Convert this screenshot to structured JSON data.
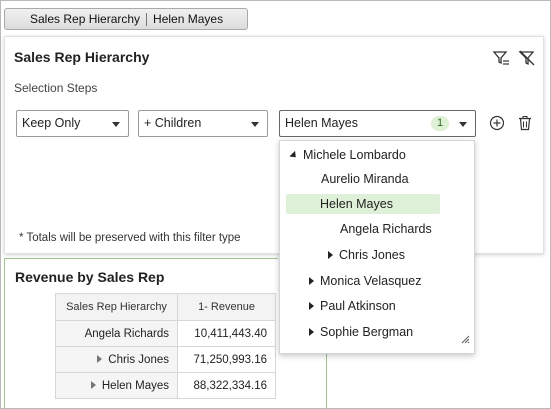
{
  "breadcrumb": {
    "part1": "Sales Rep Hierarchy",
    "part2": "Helen Mayes"
  },
  "filter_panel": {
    "title": "Sales Rep Hierarchy",
    "subtitle": "Selection Steps",
    "action_select": "Keep Only",
    "relation_select": "+ Children",
    "member_select": "Helen Mayes",
    "member_count": "1",
    "note": "* Totals will be preserved with this filter type"
  },
  "dropdown": {
    "items": [
      {
        "label": "Michele Lombardo",
        "state": "expanded"
      },
      {
        "label": "Aurelio Miranda",
        "state": "leaf"
      },
      {
        "label": "Helen Mayes",
        "state": "selected"
      },
      {
        "label": "Angela Richards",
        "state": "leaf"
      },
      {
        "label": "Chris Jones",
        "state": "collapsed"
      },
      {
        "label": "Monica Velasquez",
        "state": "collapsed"
      },
      {
        "label": "Paul Atkinson",
        "state": "collapsed"
      },
      {
        "label": "Sophie Bergman",
        "state": "collapsed"
      }
    ]
  },
  "report": {
    "title": "Revenue by Sales Rep",
    "columns": [
      "Sales Rep Hierarchy",
      "1- Revenue"
    ],
    "rows": [
      {
        "name": "Angela Richards",
        "value": "10,411,443.40",
        "expandable": false
      },
      {
        "name": "Chris Jones",
        "value": "71,250,993.16",
        "expandable": true
      },
      {
        "name": "Helen Mayes",
        "value": "88,322,334.16",
        "expandable": true
      }
    ]
  },
  "colors": {
    "selected_bg": "#dff0d8",
    "badge_bg": "#def0d6",
    "accent_line": "#9fc28f"
  }
}
